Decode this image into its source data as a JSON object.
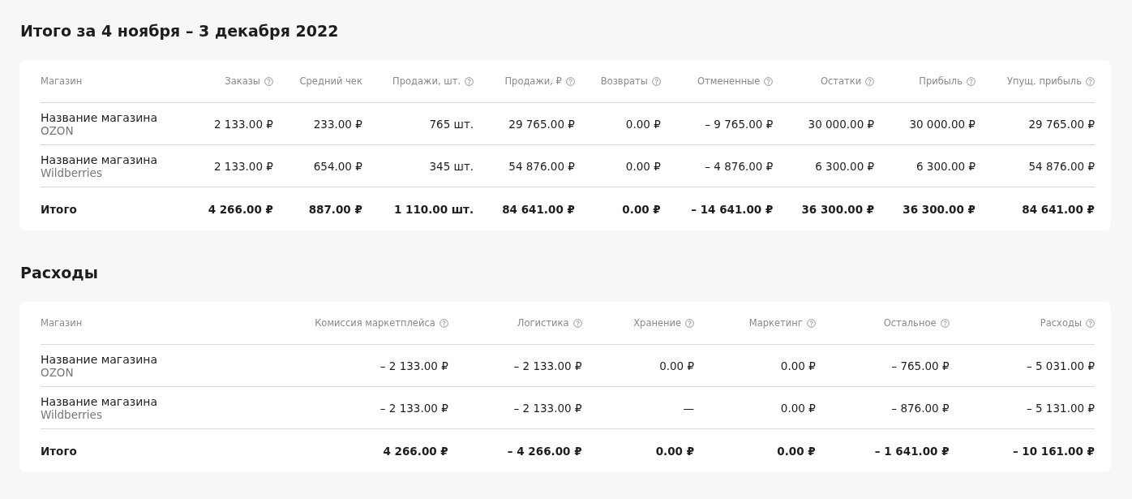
{
  "sections": [
    {
      "title": "Итого за 4 ноября – 3 декабря 2022",
      "table": {
        "columns": [
          {
            "label": "Магазин",
            "help": false
          },
          {
            "label": "Заказы",
            "help": true
          },
          {
            "label": "Средний чек",
            "help": false
          },
          {
            "label": "Продажи, шт.",
            "help": true
          },
          {
            "label": "Продажи, ₽",
            "help": true
          },
          {
            "label": "Возвраты",
            "help": true
          },
          {
            "label": "Отмененные",
            "help": true
          },
          {
            "label": "Остатки",
            "help": true
          },
          {
            "label": "Прибыль",
            "help": true
          },
          {
            "label": "Упущ. прибыль",
            "help": true
          }
        ],
        "rows": [
          {
            "marketplace": "OZON",
            "cells": [
              "Название магазина",
              "2 133.00 ₽",
              "233.00 ₽",
              "765 шт.",
              "29 765.00 ₽",
              "0.00 ₽",
              "– 9 765.00 ₽",
              "30 000.00 ₽",
              "30 000.00 ₽",
              "29 765.00 ₽"
            ]
          },
          {
            "marketplace": "Wildberries",
            "cells": [
              "Название магазина",
              "2 133.00 ₽",
              "654.00 ₽",
              "345 шт.",
              "54 876.00 ₽",
              "0.00 ₽",
              "– 4 876.00 ₽",
              "6 300.00 ₽",
              "6 300.00 ₽",
              "54 876.00 ₽"
            ]
          }
        ],
        "total": [
          "Итого",
          "4 266.00 ₽",
          "887.00 ₽",
          "1 110.00 шт.",
          "84 641.00 ₽",
          "0.00 ₽",
          "– 14 641.00 ₽",
          "36 300.00 ₽",
          "36 300.00 ₽",
          "84 641.00 ₽"
        ]
      }
    },
    {
      "title": "Расходы",
      "table": {
        "columns": [
          {
            "label": "Магазин",
            "help": false
          },
          {
            "label": "Комиссия маркетплейса",
            "help": true
          },
          {
            "label": "Логистика",
            "help": true
          },
          {
            "label": "Хранение",
            "help": true
          },
          {
            "label": "Маркетинг",
            "help": true
          },
          {
            "label": "Остальное",
            "help": true
          },
          {
            "label": "Расходы",
            "help": true
          }
        ],
        "rows": [
          {
            "marketplace": "OZON",
            "cells": [
              "Название магазина",
              "– 2 133.00 ₽",
              "– 2 133.00 ₽",
              "0.00 ₽",
              "0.00 ₽",
              "– 765.00 ₽",
              "– 5 031.00 ₽"
            ]
          },
          {
            "marketplace": "Wildberries",
            "cells": [
              "Название магазина",
              "– 2 133.00 ₽",
              "– 2 133.00 ₽",
              "—",
              "0.00 ₽",
              "– 876.00 ₽",
              "– 5 131.00 ₽"
            ]
          }
        ],
        "total": [
          "Итого",
          "4 266.00 ₽",
          "– 4 266.00 ₽",
          "0.00 ₽",
          "0.00 ₽",
          "– 1 641.00 ₽",
          "– 10 161.00 ₽"
        ]
      }
    }
  ]
}
